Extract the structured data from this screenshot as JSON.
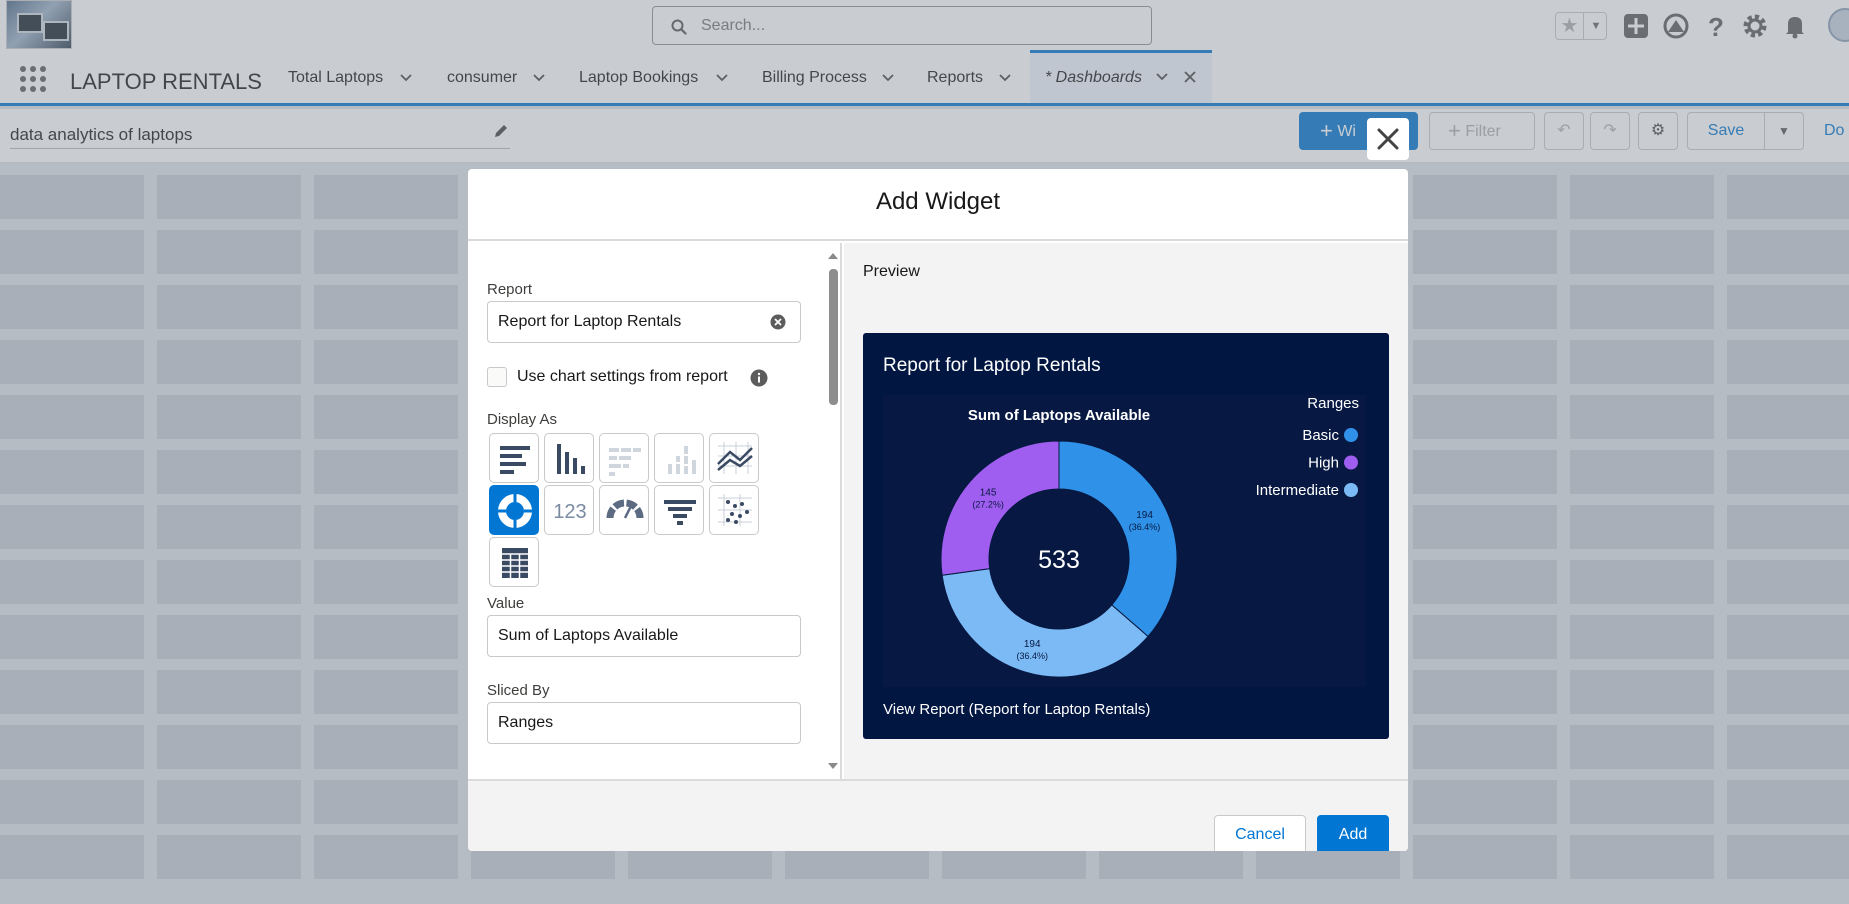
{
  "header": {
    "search_placeholder": "Search...",
    "icons": [
      "star-icon",
      "chevron-down-icon",
      "add-icon",
      "trailhead-icon",
      "help-icon",
      "gear-icon",
      "bell-icon"
    ]
  },
  "nav": {
    "app_name": "LAPTOP RENTALS",
    "tabs": [
      {
        "label": "Total Laptops"
      },
      {
        "label": "consumer"
      },
      {
        "label": "Laptop Bookings"
      },
      {
        "label": "Billing Process"
      },
      {
        "label": "Reports"
      },
      {
        "label": "* Dashboards"
      }
    ]
  },
  "toolbar": {
    "dashboard_name": "data analytics of laptops",
    "widget_label": "Wi",
    "filter_label": "Filter",
    "save_label": "Save",
    "done_label": "Do"
  },
  "modal": {
    "title": "Add Widget",
    "report_label": "Report",
    "report_value": "Report for Laptop Rentals",
    "use_chart_settings_label": "Use chart settings from report",
    "display_as_label": "Display As",
    "chart_types": [
      "horizontal-bar",
      "vertical-bar",
      "stacked-horizontal-bar",
      "stacked-vertical-bar",
      "line",
      "donut",
      "metric",
      "gauge",
      "funnel",
      "scatter",
      "lightning-table"
    ],
    "selected_chart_type": "donut",
    "value_label": "Value",
    "value_value": "Sum of Laptops Available",
    "sliced_by_label": "Sliced By",
    "sliced_by_value": "Ranges",
    "preview_label": "Preview",
    "view_report_label": "View Report (Report for Laptop Rentals)",
    "cancel_label": "Cancel",
    "add_label": "Add"
  },
  "chart_data": {
    "type": "pie",
    "title": "Report for Laptop Rentals",
    "subtitle": "Sum of Laptops Available",
    "center_total": "533",
    "legend_title": "Ranges",
    "legend_position": "top-right",
    "slices": [
      {
        "label": "Basic",
        "value": 194,
        "display": "194",
        "percent": "(36.4%)",
        "color": "#2f92e8"
      },
      {
        "label": "Intermediate",
        "value": 194,
        "display": "194",
        "percent": "(36.4%)",
        "color": "#7cbaf5"
      },
      {
        "label": "High",
        "value": 145,
        "display": "145",
        "percent": "(27.2%)",
        "color": "#a05ef0"
      }
    ],
    "legend": [
      {
        "label": "Basic",
        "color": "#2f92e8"
      },
      {
        "label": "High",
        "color": "#a05ef0"
      },
      {
        "label": "Intermediate",
        "color": "#7cbaf5"
      }
    ]
  },
  "colors": {
    "brand": "#0176d3",
    "preview_bg": "#021642"
  }
}
